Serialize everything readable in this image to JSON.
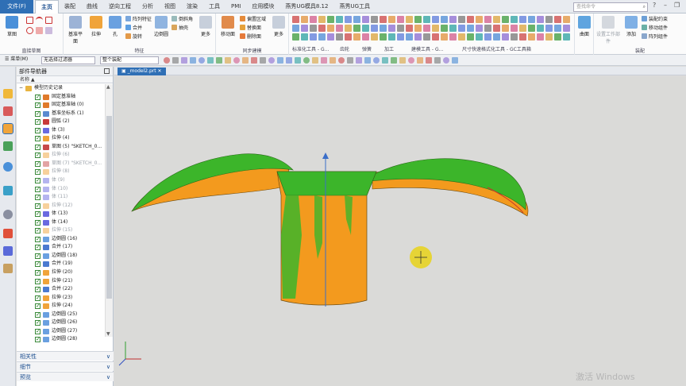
{
  "tabs": {
    "file": "文件(F)",
    "items": [
      "主页",
      "装配",
      "曲线",
      "逆向工程",
      "分析",
      "视图",
      "渲染",
      "工具",
      "PMI",
      "应用模块",
      "燕秀UG模具8.12",
      "燕秀UG工具"
    ],
    "active_index": 0
  },
  "search": {
    "placeholder": "查找命令"
  },
  "ribbon": {
    "sketch_group": {
      "label": "直接草图",
      "btn": "草图"
    },
    "feature_group": {
      "label": "特征",
      "datum": "基准平面",
      "extrude": "拉伸",
      "hole": "孔",
      "pattern": "阵列特征",
      "unite": "合并",
      "revolve": "旋转",
      "edge_blend": "边倒圆",
      "chamfer": "倒斜角",
      "shell": "抽壳",
      "more": "更多"
    },
    "sync_group": {
      "label": "同步建模",
      "move_face": "移动面",
      "offset_region": "偏置区域",
      "replace_face": "替换面",
      "delete_face": "删除面",
      "more": "更多"
    },
    "lower_labels": [
      "标准化工具 - G...",
      "齿轮",
      "弹簧",
      "加工",
      "建模工具 - G...",
      "尺寸快速格式化工具 - GC工具箱"
    ],
    "surface_group": {
      "btn": "曲面",
      "label": ""
    },
    "assembly_group": {
      "label": "装配",
      "constraint": "装配约束",
      "move": "移动组件",
      "pattern": "阵列组件",
      "add": "添加",
      "disabled": "设置工作部件"
    }
  },
  "selbar": {
    "menu": "菜单(M)",
    "filter": "无选择过滤器",
    "scope": "整个装配"
  },
  "navigator": {
    "title": "部件导航器",
    "column": "名称",
    "rows": [
      {
        "label": "模型历史记录",
        "type": "folder",
        "indent": 0,
        "dim": false
      },
      {
        "label": "固定基准轴",
        "type": "axis",
        "indent": 1,
        "dim": false
      },
      {
        "label": "固定基准轴 (0)",
        "type": "axis",
        "indent": 1,
        "dim": false
      },
      {
        "label": "基准坐标系 (1)",
        "type": "csys",
        "indent": 1,
        "dim": false
      },
      {
        "label": "圆弧 (2)",
        "type": "arc",
        "indent": 1,
        "dim": false
      },
      {
        "label": "体 (3)",
        "type": "body",
        "indent": 1,
        "dim": false
      },
      {
        "label": "拉伸 (4)",
        "type": "extrude",
        "indent": 1,
        "dim": false
      },
      {
        "label": "草图 (5) \"SKETCH_0...",
        "type": "sketch",
        "indent": 1,
        "dim": false
      },
      {
        "label": "拉伸 (6)",
        "type": "extrude",
        "indent": 1,
        "dim": true
      },
      {
        "label": "草图 (7) \"SKETCH_0...",
        "type": "sketch",
        "indent": 1,
        "dim": true
      },
      {
        "label": "拉伸 (8)",
        "type": "extrude",
        "indent": 1,
        "dim": true
      },
      {
        "label": "体 (9)",
        "type": "body",
        "indent": 1,
        "dim": true
      },
      {
        "label": "体 (10)",
        "type": "body",
        "indent": 1,
        "dim": true
      },
      {
        "label": "体 (11)",
        "type": "body",
        "indent": 1,
        "dim": true
      },
      {
        "label": "拉伸 (12)",
        "type": "extrude",
        "indent": 1,
        "dim": true
      },
      {
        "label": "体 (13)",
        "type": "body",
        "indent": 1,
        "dim": false
      },
      {
        "label": "体 (14)",
        "type": "body",
        "indent": 1,
        "dim": false
      },
      {
        "label": "拉伸 (15)",
        "type": "extrude",
        "indent": 1,
        "dim": true
      },
      {
        "label": "边倒圆 (16)",
        "type": "blend",
        "indent": 1,
        "dim": false
      },
      {
        "label": "合并 (17)",
        "type": "unite",
        "indent": 1,
        "dim": false
      },
      {
        "label": "边倒圆 (18)",
        "type": "blend",
        "indent": 1,
        "dim": false
      },
      {
        "label": "合并 (19)",
        "type": "unite",
        "indent": 1,
        "dim": false
      },
      {
        "label": "拉伸 (20)",
        "type": "extrude",
        "indent": 1,
        "dim": false
      },
      {
        "label": "拉伸 (21)",
        "type": "extrude",
        "indent": 1,
        "dim": false
      },
      {
        "label": "合并 (22)",
        "type": "unite",
        "indent": 1,
        "dim": false
      },
      {
        "label": "拉伸 (23)",
        "type": "extrude",
        "indent": 1,
        "dim": false
      },
      {
        "label": "拉伸 (24)",
        "type": "extrude",
        "indent": 1,
        "dim": false
      },
      {
        "label": "边倒圆 (25)",
        "type": "blend",
        "indent": 1,
        "dim": false
      },
      {
        "label": "边倒圆 (26)",
        "type": "blend",
        "indent": 1,
        "dim": false
      },
      {
        "label": "边倒圆 (27)",
        "type": "blend",
        "indent": 1,
        "dim": false
      },
      {
        "label": "边倒圆 (28)",
        "type": "blend",
        "indent": 1,
        "dim": false
      }
    ],
    "sections": [
      "相关性",
      "细节",
      "预览"
    ]
  },
  "viewport": {
    "tab_label": "_model2.prt"
  },
  "watermark": "激活 Windows",
  "colors": {
    "accent": "#2f6fb5",
    "body_orange": "#f39a1e",
    "body_green": "#3cb52a",
    "hud_yellow": "#e8d21a"
  },
  "icons": {
    "file_tab": "none",
    "search": "search-icon",
    "maximize": "maximize-icon",
    "scroll_up": "chevron-up-icon",
    "scroll_down": "chevron-down-icon",
    "section_expand": "chevron-down-icon",
    "tab_close": "close-icon"
  }
}
